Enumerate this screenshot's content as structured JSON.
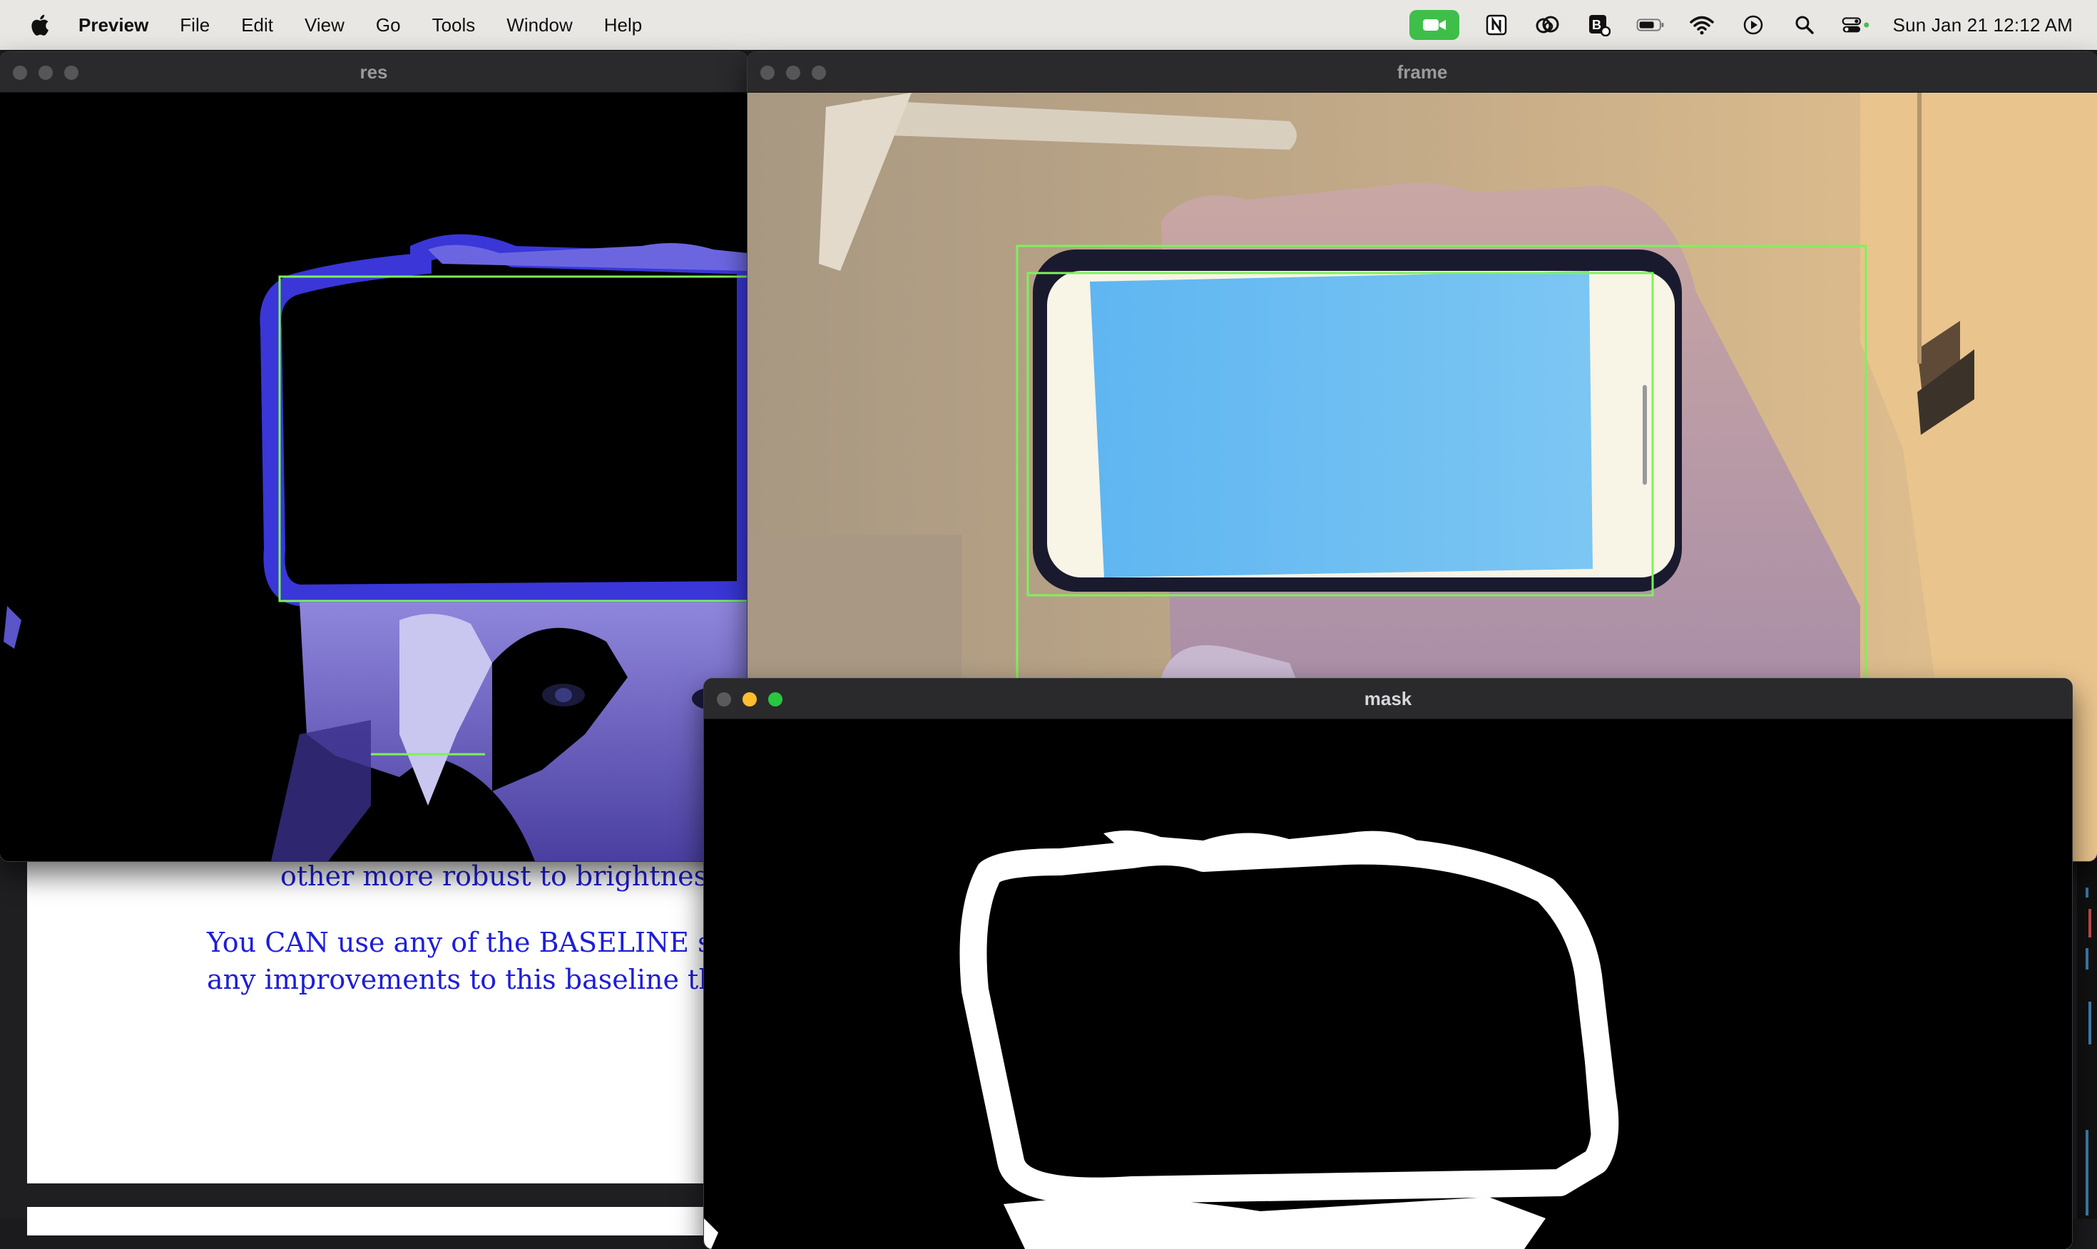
{
  "menubar": {
    "app_name": "Preview",
    "items": [
      "File",
      "Edit",
      "View",
      "Go",
      "Tools",
      "Window",
      "Help"
    ],
    "clock": "Sun Jan 21  12:12 AM"
  },
  "document": {
    "lines": [
      "other more robust to brightness?",
      "You CAN use any of the BASELINE s",
      "any improvements to this baseline that"
    ]
  },
  "windows": {
    "res": {
      "title": "res"
    },
    "frame": {
      "title": "frame"
    },
    "mask": {
      "title": "mask"
    }
  },
  "colors": {
    "detection_box": "#7cf25a",
    "phone_screen": "#6fbdf2"
  }
}
